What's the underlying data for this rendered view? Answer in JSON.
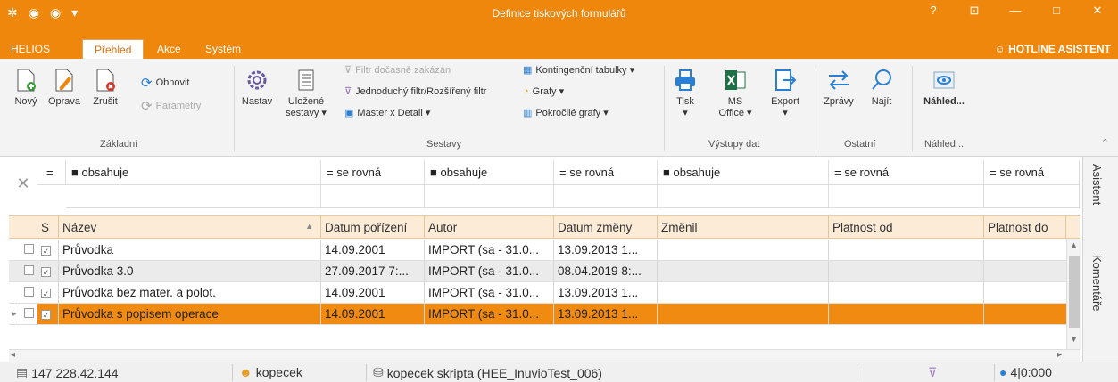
{
  "window": {
    "title": "Definice tiskových formulářů",
    "controls": [
      "?",
      "⊡",
      "—",
      "□",
      "✕"
    ]
  },
  "tabs": [
    "HELIOS",
    "Přehled",
    "Akce",
    "Systém"
  ],
  "hotline": "HOTLINE ASISTENT",
  "ribbon": {
    "zakladni": {
      "novy": "Nový",
      "oprava": "Oprava",
      "zrusit": "Zrušit",
      "obnovit": "Obnovit",
      "parametry": "Parametry",
      "group": "Základní"
    },
    "sestavy": {
      "nastav": "Nastav",
      "ulozene1": "Uložené",
      "ulozene2": "sestavy ▾",
      "filtr": "Filtr dočasně zakázán",
      "jednoduchy": "Jednoduchý filtr/Rozšířený filtr",
      "master": "Master x Detail ▾",
      "kontingencni": "Kontingenční tabulky ▾",
      "grafy": "Grafy ▾",
      "pokrocile": "Pokročilé grafy ▾",
      "group": "Sestavy"
    },
    "vystupy": {
      "tisk": "Tisk",
      "tisk_arrow": "▾",
      "ms1": "MS",
      "ms2": "Office ▾",
      "export": "Export",
      "export_arrow": "▾",
      "group": "Výstupy dat"
    },
    "ostatni": {
      "zpravy": "Zprávy",
      "najit": "Najít",
      "group": "Ostatní"
    },
    "nahled": {
      "label": "Náhled...",
      "group": "Náhled..."
    }
  },
  "filter": {
    "close": "✕",
    "cells": [
      "■ obsahuje",
      "= se rovná",
      "■ obsahuje",
      "= se rovná",
      "■ obsahuje",
      "= se rovná",
      "= se rovná"
    ],
    "eq": "="
  },
  "grid": {
    "headers": [
      "S",
      "Název",
      "Datum pořízení",
      "Autor",
      "Datum změny",
      "Změnil",
      "Platnost od",
      "Platnost do"
    ],
    "rows": [
      {
        "nazev": "Průvodka",
        "datum": "14.09.2001",
        "autor": "IMPORT (sa - 31.0...",
        "zmena": "13.09.2013 1..."
      },
      {
        "nazev": "Průvodka 3.0",
        "datum": "27.09.2017 7:...",
        "autor": "IMPORT (sa - 31.0...",
        "zmena": "08.04.2019 8:..."
      },
      {
        "nazev": "Průvodka bez mater. a polot.",
        "datum": "14.09.2001",
        "autor": "IMPORT (sa - 31.0...",
        "zmena": "13.09.2013 1..."
      },
      {
        "nazev": "Průvodka s popisem operace",
        "datum": "14.09.2001",
        "autor": "IMPORT (sa - 31.0...",
        "zmena": "13.09.2013 1..."
      }
    ]
  },
  "side": {
    "asistent": "Asistent",
    "komentare": "Komentáře"
  },
  "status": {
    "ip": "147.228.42.144",
    "user": "kopecek",
    "db": "kopecek skripta (HEE_InuvioTest_006)",
    "count": "4|0:000"
  },
  "colors": {
    "accent": "#f0870d",
    "selected_row": "#f18a11",
    "header_bg": "#fcebd6"
  }
}
